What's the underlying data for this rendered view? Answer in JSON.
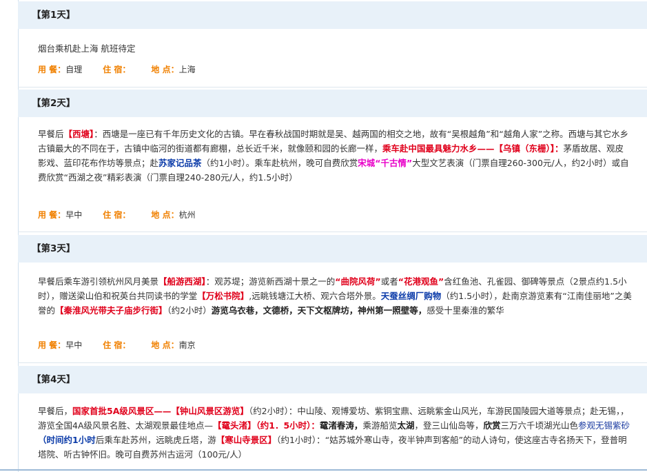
{
  "days": [
    {
      "header": "【第1天】",
      "body": [
        {
          "t": "烟台乘机赴上海   航班待定",
          "c": ""
        }
      ],
      "meta": {
        "meal_label": "用 餐：",
        "meal": "自理",
        "stay_label": "住 宿：",
        "stay": "",
        "place_label": "地 点：",
        "place": "上海"
      }
    },
    {
      "header": "【第2天】",
      "body": [
        {
          "t": "早餐后",
          "c": ""
        },
        {
          "t": "【西塘】",
          "c": "red"
        },
        {
          "t": "：西塘是一座已有千年历史文化的古镇。早在春秋战国时期就是吴、越两国的相交之地，故有“吴根越角”和“越角人家”之称。西塘与其它水乡古镇最大的不同在于，古镇中临河的街道都有廊棚，总长近千米，就像颐和园的长廊一样，",
          "c": ""
        },
        {
          "t": "乘车赴中国最具魅力水乡——【乌镇（东栅）】：",
          "c": "red"
        },
        {
          "t": "茅盾故居、观皮影戏、蓝印花布作坊等景点；赴",
          "c": ""
        },
        {
          "t": "苏家记品茶",
          "c": "blue"
        },
        {
          "t": "（约1小时）。乘车赴杭州，晚可自费欣赏",
          "c": ""
        },
        {
          "t": "宋城“千古情”",
          "c": "pink"
        },
        {
          "t": "大型文艺表演（门票自理260-300元/人，约2小时）或自费欣赏“西湖之夜”精彩表演（门票自理240-280元/人，约1.5小时）",
          "c": ""
        }
      ],
      "meta": {
        "meal_label": "用 餐：",
        "meal": "早中",
        "stay_label": "住 宿：",
        "stay": "",
        "place_label": "地 点：",
        "place": "杭州"
      }
    },
    {
      "header": "【第3天】",
      "body": [
        {
          "t": " 早餐后乘车游引领杭州风月美景",
          "c": ""
        },
        {
          "t": "【船游西湖】",
          "c": "red"
        },
        {
          "t": "：观苏堤；游览新西湖十景之一的",
          "c": ""
        },
        {
          "t": "“曲院风荷”",
          "c": "red"
        },
        {
          "t": "或者",
          "c": ""
        },
        {
          "t": "“花港观鱼”",
          "c": "red"
        },
        {
          "t": "含红鱼池、孔雀园、御碑等景点（2景点约1.5小时），赠送梁山伯和祝英台共同读书的学堂",
          "c": ""
        },
        {
          "t": "【万松书院】",
          "c": "red"
        },
        {
          "t": ",远眺钱塘江大桥、观六合塔外景。",
          "c": ""
        },
        {
          "t": "天蚕丝绸厂购物",
          "c": "blue"
        },
        {
          "t": "（约1.5小时），赴南京游览素有“江南佳丽地”之美誉的",
          "c": ""
        },
        {
          "t": "【秦淮风光带夫子庙步行街】",
          "c": "red"
        },
        {
          "t": "（约2小时）",
          "c": ""
        },
        {
          "t": "游览乌衣巷，文德桥，天下文枢牌坊，神州第一照壁等，",
          "c": "bold"
        },
        {
          "t": "感受十里秦淮的繁华",
          "c": ""
        }
      ],
      "meta": {
        "meal_label": "用 餐：",
        "meal": "早中",
        "stay_label": "住 宿：",
        "stay": "",
        "place_label": "地 点：",
        "place": "南京"
      }
    },
    {
      "header": "【第4天】",
      "body": [
        {
          "t": "早餐后，",
          "c": ""
        },
        {
          "t": "国家首批5A级风景区——【钟山风景区游览】",
          "c": "red"
        },
        {
          "t": "（约2小时）：中山陵、观博爱坊、紫铜宝鼎、远眺紫金山风光，车游民国陵园大道等景点；赴无锡，，游览全国4A级风景名胜、太湖观景最佳地点—",
          "c": ""
        },
        {
          "t": "【鼋头渚】（约1．5小时）：",
          "c": "red"
        },
        {
          "t": "鼋渚春涛，",
          "c": "bold"
        },
        {
          "t": "乘游船览",
          "c": ""
        },
        {
          "t": "太湖",
          "c": "bold"
        },
        {
          "t": "，登三山仙岛等，",
          "c": ""
        },
        {
          "t": "欣赏",
          "c": "bold"
        },
        {
          "t": "三万六千顷湖光山色",
          "c": ""
        },
        {
          "t": "参观无锡紫砂",
          "c": "navy"
        },
        {
          "t": "（时间约1小时",
          "c": "blue"
        },
        {
          "t": "后乘车赴苏州，远眺虎丘塔，游",
          "c": ""
        },
        {
          "t": "【寒山寺景区】",
          "c": "red"
        },
        {
          "t": "（约1小时）：“姑苏城外寒山寺，夜半钟声到客船”的动人诗句，使这座古寺名扬天下，登普明塔院、听古钟怀旧。晚可自费苏州古运河（100元/人）",
          "c": ""
        }
      ]
    }
  ]
}
